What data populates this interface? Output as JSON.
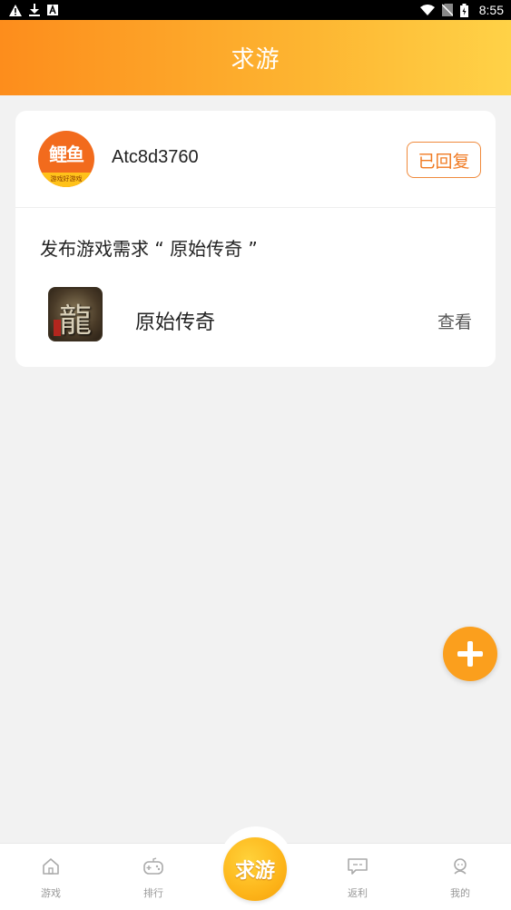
{
  "status_bar": {
    "time": "8:55",
    "left_icons": [
      "warning-icon",
      "download-icon",
      "font-icon"
    ],
    "right_icons": [
      "wifi-icon",
      "no-sim-icon",
      "battery-icon"
    ]
  },
  "header": {
    "title": "求游"
  },
  "post": {
    "username": "Atc8d3760",
    "avatar_logo_text": "鲤鱼",
    "avatar_band_text": "游戏好游戏",
    "status_badge": "已回复",
    "request_text": "发布游戏需求 “ 原始传奇 ”",
    "game": {
      "thumb_char": "龍",
      "name": "原始传奇",
      "view_label": "查看"
    }
  },
  "fab": {
    "icon": "plus-icon"
  },
  "bottom_nav": {
    "items": [
      {
        "label": "游戏",
        "icon": "home-icon"
      },
      {
        "label": "排行",
        "icon": "gamepad-icon"
      },
      {
        "label": "求游",
        "icon": "center-button"
      },
      {
        "label": "返利",
        "icon": "chat-icon"
      },
      {
        "label": "我的",
        "icon": "profile-icon"
      }
    ]
  },
  "colors": {
    "accent": "#fd8d1c",
    "badge": "#f07a22",
    "fab": "#fb9f1d",
    "center_nav": "#fdb51a"
  }
}
